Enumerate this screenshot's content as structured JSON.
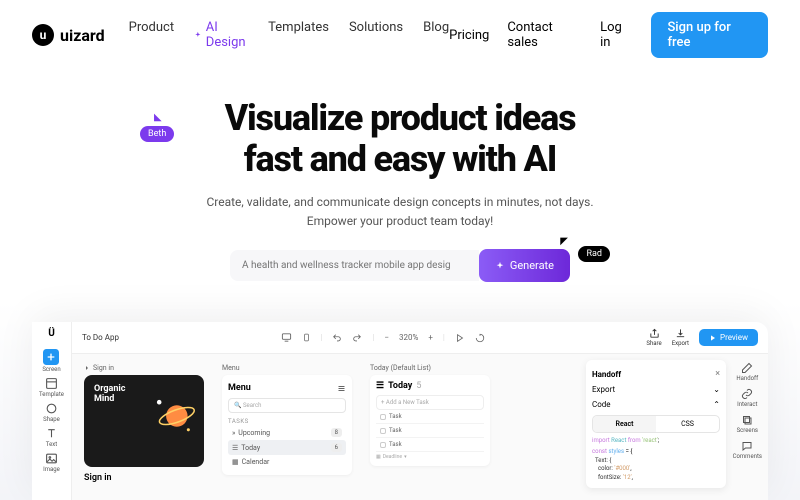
{
  "nav": {
    "logo": "uizard",
    "links": {
      "product": "Product",
      "ai": "AI Design",
      "templates": "Templates",
      "solutions": "Solutions",
      "blog": "Blog"
    },
    "right": {
      "pricing": "Pricing",
      "contact": "Contact sales",
      "login": "Log in",
      "signup": "Sign up for free"
    }
  },
  "hero": {
    "h1a": "Visualize product ideas",
    "h1b": "fast and easy with AI",
    "sub1": "Create, validate, and communicate design concepts in minutes, not days.",
    "sub2": "Empower your product team today!",
    "tag_beth": "Beth",
    "tag_rad": "Rad",
    "prompt_placeholder": "A health and wellness tracker mobile app desig",
    "generate": "Generate"
  },
  "editor": {
    "project": "To Do App",
    "tools": {
      "screen": "Screen",
      "template": "Template",
      "shape": "Shape",
      "text": "Text",
      "image": "Image"
    },
    "zoom": "320%",
    "share": "Share",
    "export": "Export",
    "preview": "Preview",
    "right_tools": {
      "handoff": "Handoff",
      "interact": "Interact",
      "screens": "Screens",
      "comments": "Comments"
    },
    "signin": {
      "label": "Sign in",
      "title1": "Organic",
      "title2": "Mind",
      "bottom": "Sign in"
    },
    "menu": {
      "top": "Menu",
      "title": "Menu",
      "search": "Search",
      "tasks": "TASKS",
      "upcoming": "Upcoming",
      "upcoming_count": "8",
      "today": "Today",
      "today_count": "6",
      "calendar": "Calendar"
    },
    "today": {
      "lbl": "Today (Default List)",
      "title": "Today",
      "count": "5",
      "add": "Add a New Task",
      "task": "Task",
      "deadline": "Deadline"
    },
    "handoff": {
      "title": "Handoff",
      "export": "Export",
      "code": "Code",
      "react": "React",
      "css": "CSS",
      "code_import_kw": "import",
      "code_import_mod": "React",
      "code_import_from": "from",
      "code_import_str": "'react'",
      "code_const": "const",
      "code_var": "styles",
      "code_eq": " = {",
      "code_text": "Text: {",
      "code_color": "color:",
      "code_color_val": "'#000'",
      "code_fontsize": "fontSize:",
      "code_fontsize_val": "'12'"
    }
  }
}
